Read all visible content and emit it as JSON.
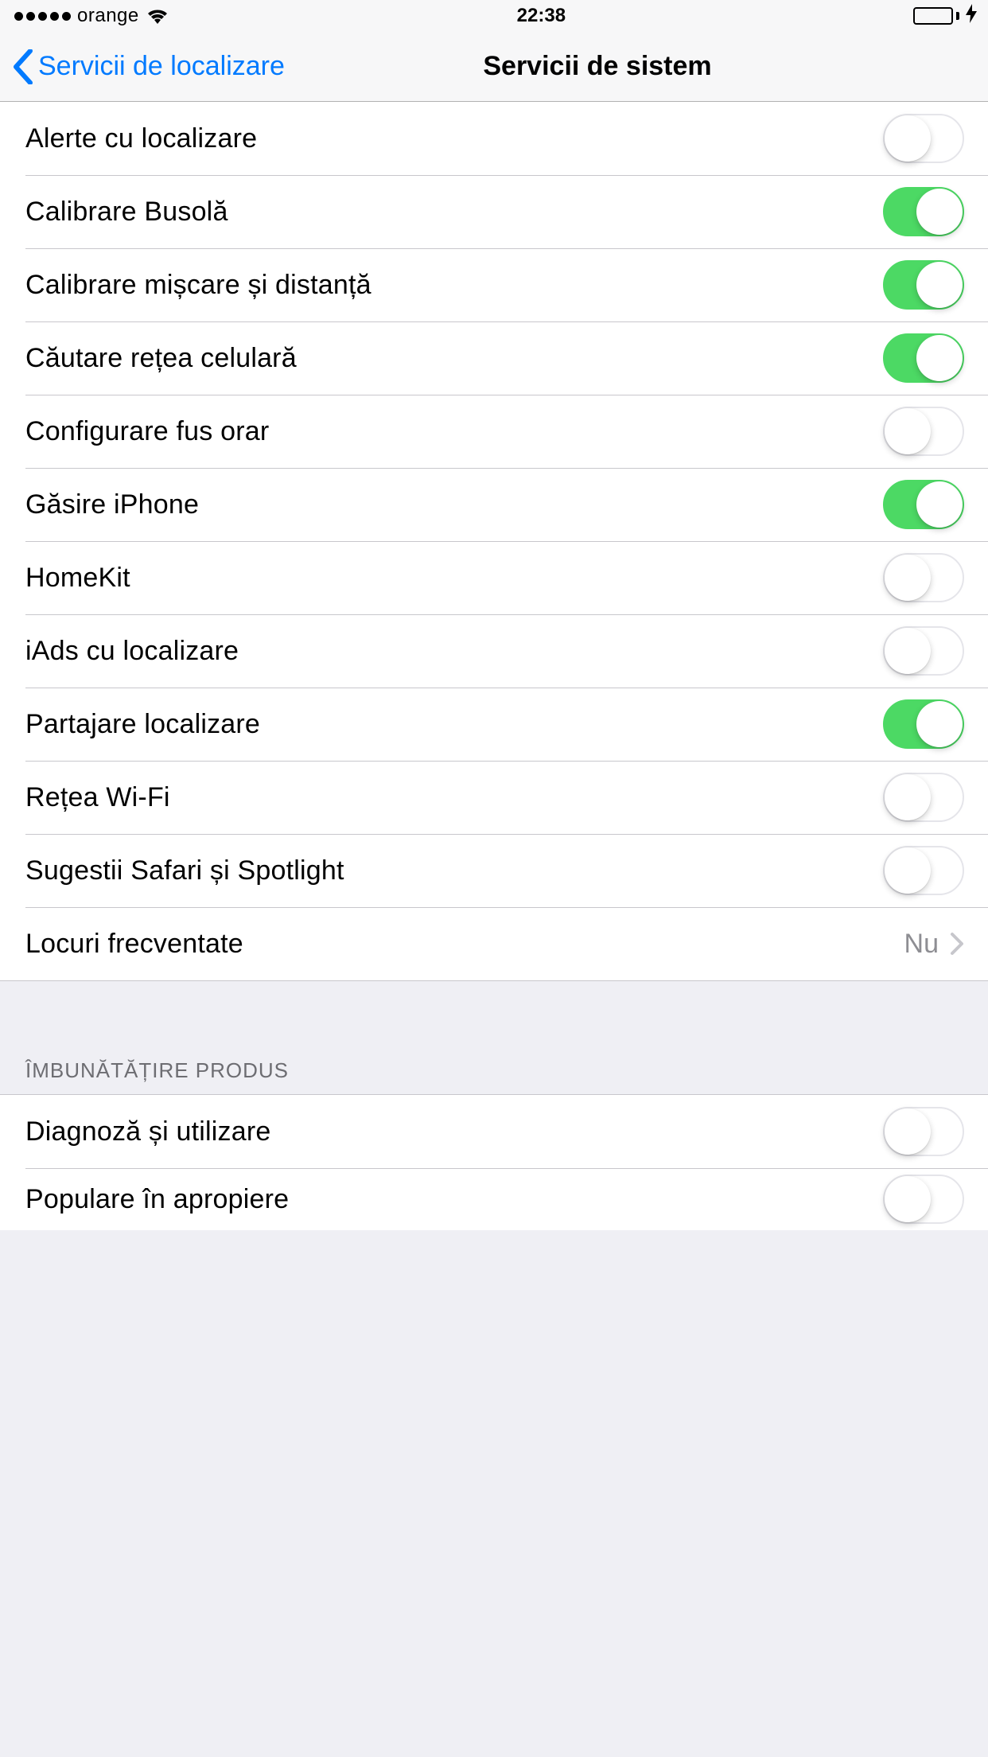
{
  "status_bar": {
    "carrier": "orange",
    "time": "22:38"
  },
  "nav": {
    "back_label": "Servicii de localizare",
    "title": "Servicii de sistem"
  },
  "rows": [
    {
      "label": "Alerte cu localizare",
      "on": false
    },
    {
      "label": "Calibrare Busolă",
      "on": true
    },
    {
      "label": "Calibrare mișcare și distanță",
      "on": true
    },
    {
      "label": "Căutare rețea celulară",
      "on": true
    },
    {
      "label": "Configurare fus orar",
      "on": false
    },
    {
      "label": "Găsire iPhone",
      "on": true
    },
    {
      "label": "HomeKit",
      "on": false
    },
    {
      "label": "iAds cu localizare",
      "on": false
    },
    {
      "label": "Partajare localizare",
      "on": true
    },
    {
      "label": "Rețea Wi-Fi",
      "on": false
    },
    {
      "label": "Sugestii Safari și Spotlight",
      "on": false
    }
  ],
  "frequent": {
    "label": "Locuri frecventate",
    "value": "Nu"
  },
  "section2_header": "ÎMBUNĂTĂȚIRE PRODUS",
  "rows2": [
    {
      "label": "Diagnoză și utilizare",
      "on": false
    },
    {
      "label": "Populare în apropiere",
      "on": false
    }
  ]
}
